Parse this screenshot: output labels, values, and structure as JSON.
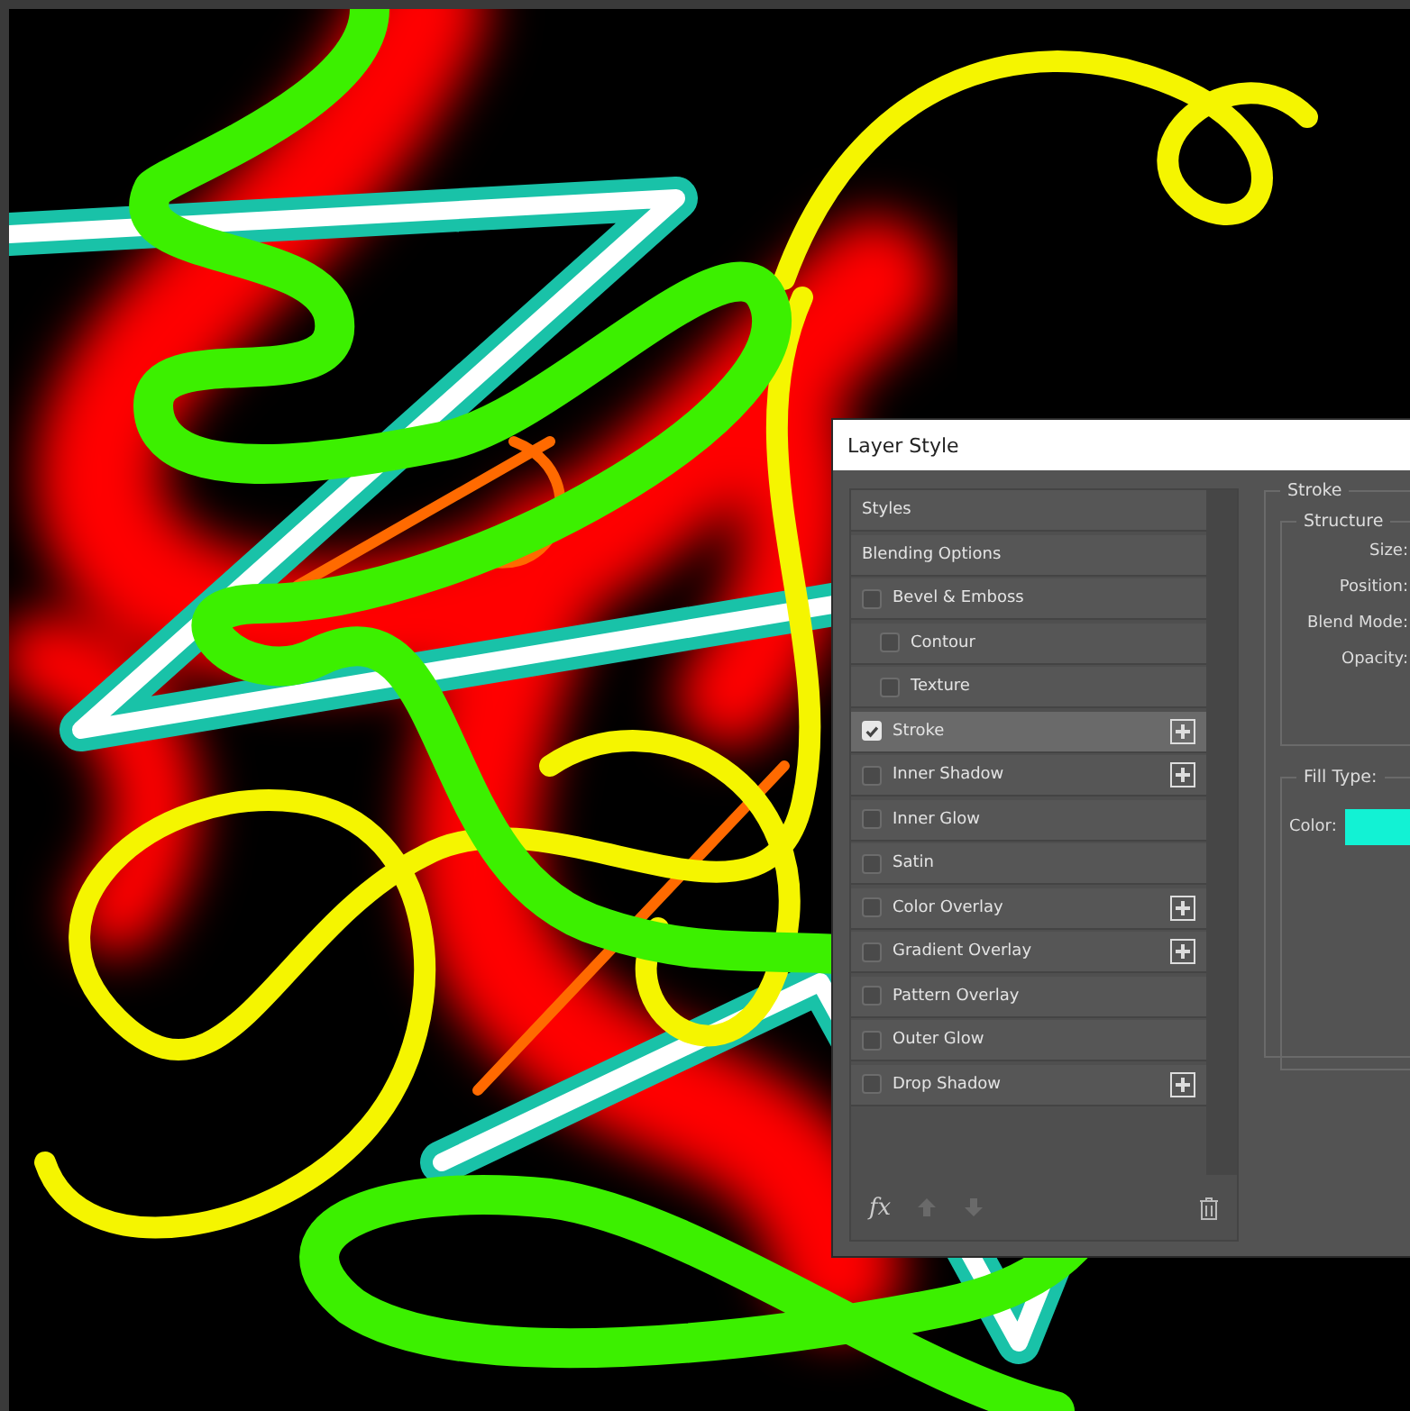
{
  "window": {
    "title": "Layer Style"
  },
  "styles_list": {
    "items": [
      {
        "kind": "header",
        "label": "Styles",
        "selected": false
      },
      {
        "kind": "header",
        "label": "Blending Options",
        "selected": false
      },
      {
        "kind": "effect",
        "label": "Bevel & Emboss",
        "checked": false,
        "selected": false,
        "addable": false,
        "children": [
          {
            "kind": "effect",
            "label": "Contour",
            "checked": false,
            "selected": false,
            "addable": false
          },
          {
            "kind": "effect",
            "label": "Texture",
            "checked": false,
            "selected": false,
            "addable": false
          }
        ]
      },
      {
        "kind": "effect",
        "label": "Stroke",
        "checked": true,
        "selected": true,
        "addable": true
      },
      {
        "kind": "effect",
        "label": "Inner Shadow",
        "checked": false,
        "selected": false,
        "addable": true
      },
      {
        "kind": "effect",
        "label": "Inner Glow",
        "checked": false,
        "selected": false,
        "addable": false
      },
      {
        "kind": "effect",
        "label": "Satin",
        "checked": false,
        "selected": false,
        "addable": false
      },
      {
        "kind": "effect",
        "label": "Color Overlay",
        "checked": false,
        "selected": false,
        "addable": true
      },
      {
        "kind": "effect",
        "label": "Gradient Overlay",
        "checked": false,
        "selected": false,
        "addable": true
      },
      {
        "kind": "effect",
        "label": "Pattern Overlay",
        "checked": false,
        "selected": false,
        "addable": false
      },
      {
        "kind": "effect",
        "label": "Outer Glow",
        "checked": false,
        "selected": false,
        "addable": false
      },
      {
        "kind": "effect",
        "label": "Drop Shadow",
        "checked": false,
        "selected": false,
        "addable": true
      }
    ]
  },
  "bottom_bar": {
    "fx_label": "fx"
  },
  "stroke_panel": {
    "title": "Stroke",
    "structure": {
      "title": "Structure",
      "labels": [
        "Size:",
        "Position:",
        "Blend Mode:",
        "Opacity:"
      ]
    },
    "fill_type_label": "Fill Type:",
    "color_label": "Color:",
    "swatch": {
      "color": "#12f2d4"
    }
  }
}
